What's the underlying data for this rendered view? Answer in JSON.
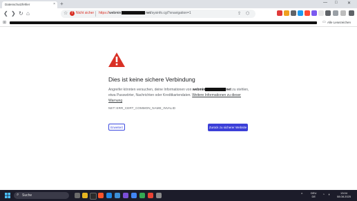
{
  "tab": {
    "title": "Datenschutzfehler",
    "close": "×"
  },
  "new_tab": "+",
  "window_controls": {
    "minimize": "—",
    "maximize": "□",
    "close": "✕"
  },
  "nav": {
    "back": "❮",
    "forward": "❯",
    "reload": "↻",
    "home": "⌂"
  },
  "address_bar": {
    "security_label": "Nicht sicher",
    "url_scheme": "https://",
    "url_host_start": "webmin",
    "url_host_end": "net",
    "url_path": "/sysinfo.cgi?xnavigation=1"
  },
  "bookmarks_bar": {
    "all_bookmarks": "Alle Lesezeichen"
  },
  "error_page": {
    "heading": "Dies ist keine sichere Verbindung",
    "text_before": "Angreifer könnten versuchen, deine Informationen von ",
    "domain_start": "webmin",
    "domain_end": "net",
    "text_after": " zu stehlen, etwa Passwörter, Nachrichten oder Kreditkartendaten. ",
    "more_info_link": "Weitere Informationen zu dieser Warnung",
    "error_code": "NET::ERR_CERT_COMMON_NAME_INVALID",
    "advanced_button": "Erweitert",
    "back_button": "Zurück zu sicherer Website"
  },
  "taskbar": {
    "search_placeholder": "Suche",
    "language_line1": "DEU",
    "language_line2": "DE",
    "time": "13:04",
    "date": "08.08.2025"
  },
  "colors": {
    "warning_red": "#d93025",
    "primary_button": "#3b3fd8",
    "taskbar": "#1c1c2a"
  }
}
